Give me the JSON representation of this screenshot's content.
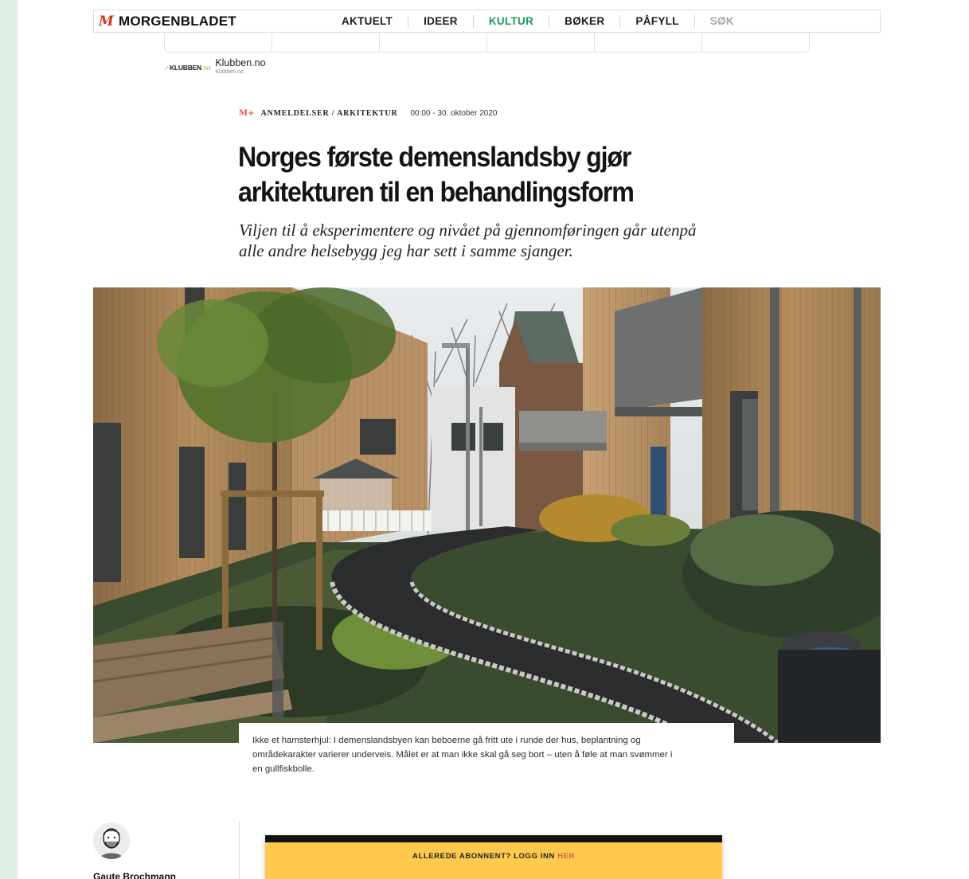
{
  "header": {
    "logo_mark": "M",
    "logo_text": "MORGENBLADET",
    "nav": [
      {
        "label": "AKTUELT",
        "state": "normal"
      },
      {
        "label": "IDEER",
        "state": "normal"
      },
      {
        "label": "KULTUR",
        "state": "active"
      },
      {
        "label": "BØKER",
        "state": "normal"
      },
      {
        "label": "PÅFYLL",
        "state": "normal"
      },
      {
        "label": "SØK",
        "state": "muted"
      }
    ],
    "accent_color": "#1b9c5a"
  },
  "sponsor": {
    "logo_prefix": "KLUBBEN",
    "logo_suffix": ".no",
    "title": "Klubben.no",
    "subtitle": "Klubben.no"
  },
  "article": {
    "kicker_icon": "M+",
    "category": "ANMELDELSER / ARKITEKTUR",
    "date": "00:00 - 30. oktober 2020",
    "headline_line1": "Norges første demenslandsby gjør",
    "headline_line2": "arkitekturen til en behandlingsform",
    "lede_line1": "Viljen til å eksperimentere og nivået på gjennomføringen går utenpå",
    "lede_line2": "alle andre helsebygg jeg har sett i samme sjanger.",
    "caption_line1": "Ikke et hamsterhjul: I demenslandsbyen kan beboerne gå fritt ute i runde der hus, beplantning og",
    "caption_line2": "områdekarakter varierer underveis. Målet er at man ikke skal gå seg bort – uten å føle at man svømmer i",
    "caption_line3": "en gullfiskbolle."
  },
  "byline": {
    "author": "Gaute Brochmann"
  },
  "paywall": {
    "text": "ALLEREDE ABONNENT? LOGG INN ",
    "link": "HER",
    "background": "#ffc94e"
  }
}
